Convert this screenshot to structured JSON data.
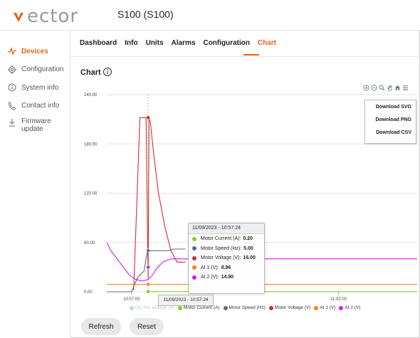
{
  "app": {
    "logo_text": "ector",
    "device_title": "S100 (S100)",
    "accent": "#e8631a"
  },
  "sidebar": {
    "items": [
      {
        "label": "Devices",
        "icon": "pulse-icon",
        "active": true
      },
      {
        "label": "Configuration",
        "icon": "gear-icon",
        "active": false
      },
      {
        "label": "System info",
        "icon": "info-circle-icon",
        "active": false
      },
      {
        "label": "Contact info",
        "icon": "phone-icon",
        "active": false
      },
      {
        "label": "Firmware update",
        "label_line1": "Firmware",
        "label_line2": "update",
        "icon": "download-icon",
        "active": false
      }
    ]
  },
  "tabs": [
    {
      "label": "Dashboard",
      "active": false
    },
    {
      "label": "Info",
      "active": false
    },
    {
      "label": "Units",
      "active": false
    },
    {
      "label": "Alarms",
      "active": false
    },
    {
      "label": "Configuration",
      "active": false
    },
    {
      "label": "Chart",
      "active": true
    }
  ],
  "chart_section": {
    "heading": "Chart"
  },
  "toolbar_icons": [
    "zoom-in-icon",
    "zoom-out-icon",
    "magnifier-icon",
    "pan-hand-icon",
    "home-icon",
    "menu-icon"
  ],
  "download_menu": [
    "Download SVG",
    "Download PNG",
    "Download CSV"
  ],
  "chart_data": {
    "type": "line",
    "y_ticks": [
      "240.00",
      "180.00",
      "120.00",
      "60.00",
      "0.00"
    ],
    "ylim": [
      0,
      240
    ],
    "x_tick_labels": [
      "10:57:00",
      "11:02:00"
    ],
    "x_tick_minutes": [
      0,
      5
    ],
    "xlim_minutes": [
      -0.6,
      6.9
    ],
    "cursor_minutes": 0.4,
    "series": [
      {
        "name": "DC link Voltage (V)",
        "color": "#b8d8f0",
        "hidden": true,
        "points": []
      },
      {
        "name": "Motor Current (A)",
        "color": "#7ed321",
        "hidden": false,
        "points": [
          [
            0.4,
            0.2
          ],
          [
            6.9,
            0.2
          ]
        ]
      },
      {
        "name": "Motor Speed (Hz)",
        "color": "#5b6c7f",
        "hidden": false,
        "points": [
          [
            -0.6,
            0
          ],
          [
            0.0,
            0
          ],
          [
            0.15,
            18
          ],
          [
            0.3,
            25
          ],
          [
            0.38,
            50
          ],
          [
            0.45,
            50
          ],
          [
            0.6,
            50
          ],
          [
            0.75,
            50
          ],
          [
            0.9,
            50
          ],
          [
            1.0,
            52
          ],
          [
            1.3,
            52
          ]
        ]
      },
      {
        "name": "Motor Voltage (V)",
        "color": "#d0312d",
        "hidden": false,
        "points": [
          [
            0.05,
            2
          ],
          [
            0.2,
            212
          ],
          [
            0.35,
            212
          ],
          [
            0.4,
            16
          ],
          [
            0.42,
            212
          ],
          [
            0.45,
            208
          ],
          [
            0.55,
            160
          ],
          [
            0.65,
            120
          ],
          [
            0.8,
            80
          ],
          [
            0.95,
            50
          ],
          [
            1.1,
            36
          ],
          [
            1.3,
            36
          ]
        ]
      },
      {
        "name": "AI 1 (V)",
        "color": "#ff7f1e",
        "hidden": false,
        "points": [
          [
            -0.6,
            8.96
          ],
          [
            6.9,
            8.96
          ]
        ]
      },
      {
        "name": "AI 2 (V)",
        "color": "#d21ee8",
        "hidden": false,
        "points": [
          [
            -0.6,
            60
          ],
          [
            -0.5,
            50
          ],
          [
            -0.35,
            40
          ],
          [
            -0.2,
            30
          ],
          [
            -0.05,
            20
          ],
          [
            0.1,
            15
          ],
          [
            0.25,
            13
          ],
          [
            0.4,
            14.9
          ],
          [
            0.5,
            20
          ],
          [
            0.6,
            28
          ],
          [
            0.75,
            36
          ],
          [
            0.95,
            40
          ],
          [
            1.3,
            40
          ],
          [
            6.9,
            40
          ]
        ]
      }
    ]
  },
  "tooltip": {
    "title": "11/09/2023 - 10:57:24",
    "rows": [
      {
        "label": "Motor Current (A):",
        "value": "0.20",
        "color": "#7ed321"
      },
      {
        "label": "Motor Speed (Hz):",
        "value": "5.00",
        "color": "#5b6c7f"
      },
      {
        "label": "Motor Voltage (V):",
        "value": "16.00",
        "color": "#d0312d"
      },
      {
        "label": "AI 1 (V):",
        "value": "8.96",
        "color": "#ff7f1e"
      },
      {
        "label": "AI 2 (V):",
        "value": "14.90",
        "color": "#d21ee8"
      }
    ]
  },
  "x_crosshair_label": "11/09/2023 - 10:57:24",
  "legend": [
    {
      "label": "DC link Voltage (V)",
      "color": "#b8d8f0",
      "dim": true
    },
    {
      "label": "Motor Current (A)",
      "color": "#7ed321",
      "dim": false
    },
    {
      "label": "Motor Speed (Hz)",
      "color": "#5b6c7f",
      "dim": false
    },
    {
      "label": "Motor Voltage (V)",
      "color": "#d0312d",
      "dim": false
    },
    {
      "label": "AI 1 (V)",
      "color": "#ff7f1e",
      "dim": false
    },
    {
      "label": "AI 2 (V)",
      "color": "#d21ee8",
      "dim": false
    }
  ],
  "buttons": {
    "refresh": "Refresh",
    "reset": "Reset"
  }
}
